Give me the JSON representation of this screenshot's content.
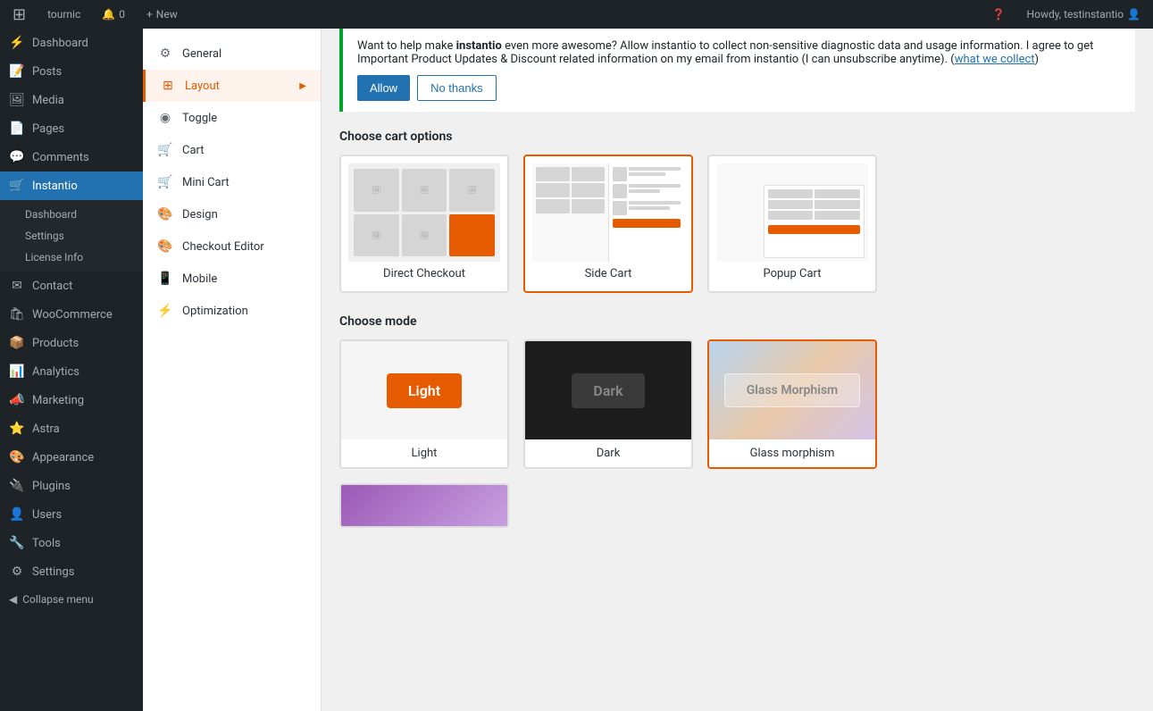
{
  "adminBar": {
    "siteName": "tournic",
    "notifCount": "0",
    "newLabel": "New",
    "helpLabel": "?",
    "howdy": "Howdy, testinstantio"
  },
  "sidebar": {
    "items": [
      {
        "id": "dashboard",
        "label": "Dashboard",
        "icon": "⚡"
      },
      {
        "id": "posts",
        "label": "Posts",
        "icon": "📝"
      },
      {
        "id": "media",
        "label": "Media",
        "icon": "🖼"
      },
      {
        "id": "pages",
        "label": "Pages",
        "icon": "📄"
      },
      {
        "id": "comments",
        "label": "Comments",
        "icon": "💬"
      },
      {
        "id": "instantio",
        "label": "Instantio",
        "icon": "🛒",
        "active": true
      },
      {
        "id": "contact",
        "label": "Contact",
        "icon": "✉"
      },
      {
        "id": "woocommerce",
        "label": "WooCommerce",
        "icon": "🛍"
      },
      {
        "id": "products",
        "label": "Products",
        "icon": "📦"
      },
      {
        "id": "analytics",
        "label": "Analytics",
        "icon": "📊"
      },
      {
        "id": "marketing",
        "label": "Marketing",
        "icon": "📣"
      },
      {
        "id": "astra",
        "label": "Astra",
        "icon": "⭐"
      },
      {
        "id": "appearance",
        "label": "Appearance",
        "icon": "🎨"
      },
      {
        "id": "plugins",
        "label": "Plugins",
        "icon": "🔌"
      },
      {
        "id": "users",
        "label": "Users",
        "icon": "👤"
      },
      {
        "id": "tools",
        "label": "Tools",
        "icon": "🔧"
      },
      {
        "id": "settings",
        "label": "Settings",
        "icon": "⚙"
      }
    ],
    "instantioSub": [
      {
        "label": "Dashboard"
      },
      {
        "label": "Settings"
      },
      {
        "label": "License Info"
      }
    ],
    "collapseLabel": "Collapse menu"
  },
  "notice": {
    "text1": "Want to help make ",
    "brand": "instantio",
    "text2": " even more awesome? Allow instantio to collect non-sensitive diagnostic data and usage information. I agree to get Important Product Updates & Discount related information on my email from instantio (I can unsubscribe anytime). (",
    "linkText": "what we collect",
    "text3": ")",
    "allowLabel": "Allow",
    "noThanksLabel": "No thanks"
  },
  "subNav": {
    "items": [
      {
        "id": "general",
        "label": "General",
        "icon": "⚙",
        "active": false
      },
      {
        "id": "layout",
        "label": "Layout",
        "icon": "⊞",
        "active": true,
        "hasArrow": true
      },
      {
        "id": "toggle",
        "label": "Toggle",
        "icon": "◉",
        "active": false
      },
      {
        "id": "cart",
        "label": "Cart",
        "icon": "🛒",
        "active": false
      },
      {
        "id": "mini-cart",
        "label": "Mini Cart",
        "icon": "🛒",
        "active": false
      },
      {
        "id": "design",
        "label": "Design",
        "icon": "🎨",
        "active": false
      },
      {
        "id": "checkout-editor",
        "label": "Checkout Editor",
        "icon": "🎨",
        "active": false
      },
      {
        "id": "mobile",
        "label": "Mobile",
        "icon": "📱",
        "active": false
      },
      {
        "id": "optimization",
        "label": "Optimization",
        "icon": "⚡",
        "active": false
      }
    ]
  },
  "mainContent": {
    "cartOptions": {
      "sectionTitle": "Choose cart options",
      "cards": [
        {
          "id": "direct-checkout",
          "label": "Direct Checkout",
          "selected": false
        },
        {
          "id": "side-cart",
          "label": "Side Cart",
          "selected": true
        },
        {
          "id": "popup-cart",
          "label": "Popup Cart",
          "selected": false
        }
      ]
    },
    "modeOptions": {
      "sectionTitle": "Choose mode",
      "cards": [
        {
          "id": "light",
          "label": "Light",
          "selected": false
        },
        {
          "id": "dark",
          "label": "Dark",
          "selected": false
        },
        {
          "id": "glass-morphism",
          "label": "Glass morphism",
          "selected": true
        }
      ]
    }
  }
}
